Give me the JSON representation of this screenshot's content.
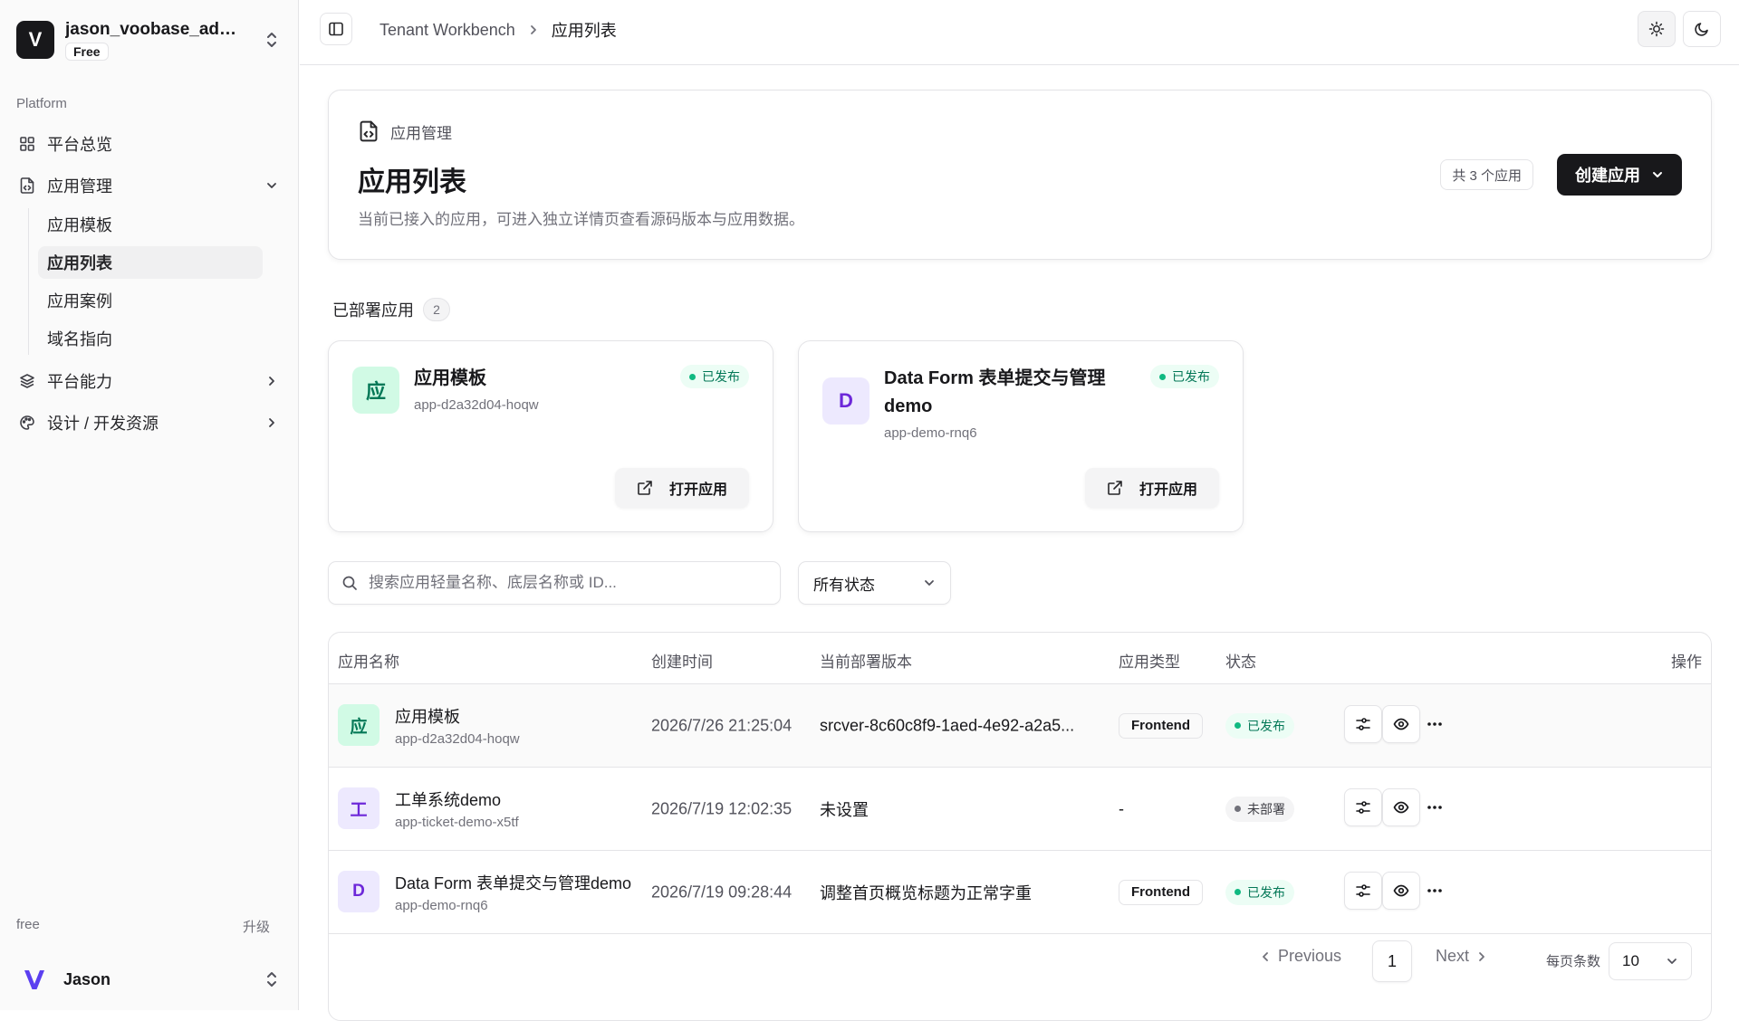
{
  "workspace": {
    "name": "jason_voobase_admi...",
    "plan": "Free"
  },
  "sidebar": {
    "section_label": "Platform",
    "items": [
      {
        "label": "平台总览",
        "icon": "grid-icon"
      },
      {
        "label": "应用管理",
        "icon": "file-code-icon",
        "expanded": true,
        "children": [
          {
            "label": "应用模板"
          },
          {
            "label": "应用列表",
            "active": true
          },
          {
            "label": "应用案例"
          },
          {
            "label": "域名指向"
          }
        ]
      },
      {
        "label": "平台能力",
        "icon": "layers-icon"
      },
      {
        "label": "设计 / 开发资源",
        "icon": "palette-icon"
      }
    ],
    "plan_label": "free",
    "upgrade_label": "升级",
    "user_name": "Jason"
  },
  "topbar": {
    "breadcrumb": [
      "Tenant Workbench",
      "应用列表"
    ]
  },
  "hero": {
    "kicker": "应用管理",
    "title": "应用列表",
    "description": "当前已接入的应用，可进入独立详情页查看源码版本与应用数据。",
    "count_label": "共 3 个应用",
    "create_label": "创建应用"
  },
  "deployed": {
    "heading": "已部署应用",
    "count": "2",
    "cards": [
      {
        "icon_letter": "应",
        "title": "应用模板",
        "id": "app-d2a32d04-hoqw",
        "status": "已发布",
        "open_label": "打开应用"
      },
      {
        "icon_letter": "D",
        "title": "Data Form 表单提交与管理 demo",
        "id": "app-demo-rnq6",
        "status": "已发布",
        "open_label": "打开应用"
      }
    ]
  },
  "filters": {
    "search_placeholder": "搜索应用轻量名称、底层名称或 ID...",
    "status_value": "所有状态"
  },
  "table": {
    "columns": [
      "应用名称",
      "创建时间",
      "当前部署版本",
      "应用类型",
      "状态",
      "操作"
    ],
    "rows": [
      {
        "icon_letter": "应",
        "name": "应用模板",
        "id": "app-d2a32d04-hoqw",
        "created": "2026/7/26 21:25:04",
        "version": "srcver-8c60c8f9-1aed-4e92-a2a5...",
        "type": "Frontend",
        "status": "已发布"
      },
      {
        "icon_letter": "工",
        "name": "工单系统demo",
        "id": "app-ticket-demo-x5tf",
        "created": "2026/7/19 12:02:35",
        "version": "未设置",
        "type": "-",
        "status": "未部署"
      },
      {
        "icon_letter": "D",
        "name": "Data Form 表单提交与管理demo",
        "id": "app-demo-rnq6",
        "created": "2026/7/19 09:28:44",
        "version": "调整首页概览标题为正常字重",
        "type": "Frontend",
        "status": "已发布"
      }
    ]
  },
  "pagination": {
    "prev_label": "Previous",
    "current_page": "1",
    "next_label": "Next",
    "page_size_label": "每页条数",
    "page_size": "10"
  },
  "colors": {
    "primary": "#18181b",
    "published_text": "#047857",
    "published_bg": "#ecfdf5",
    "app_icon_green_bg": "#d1fae5",
    "app_icon_purple_bg": "#ede9fe",
    "app_icon_purple_text": "#6d28d9"
  }
}
